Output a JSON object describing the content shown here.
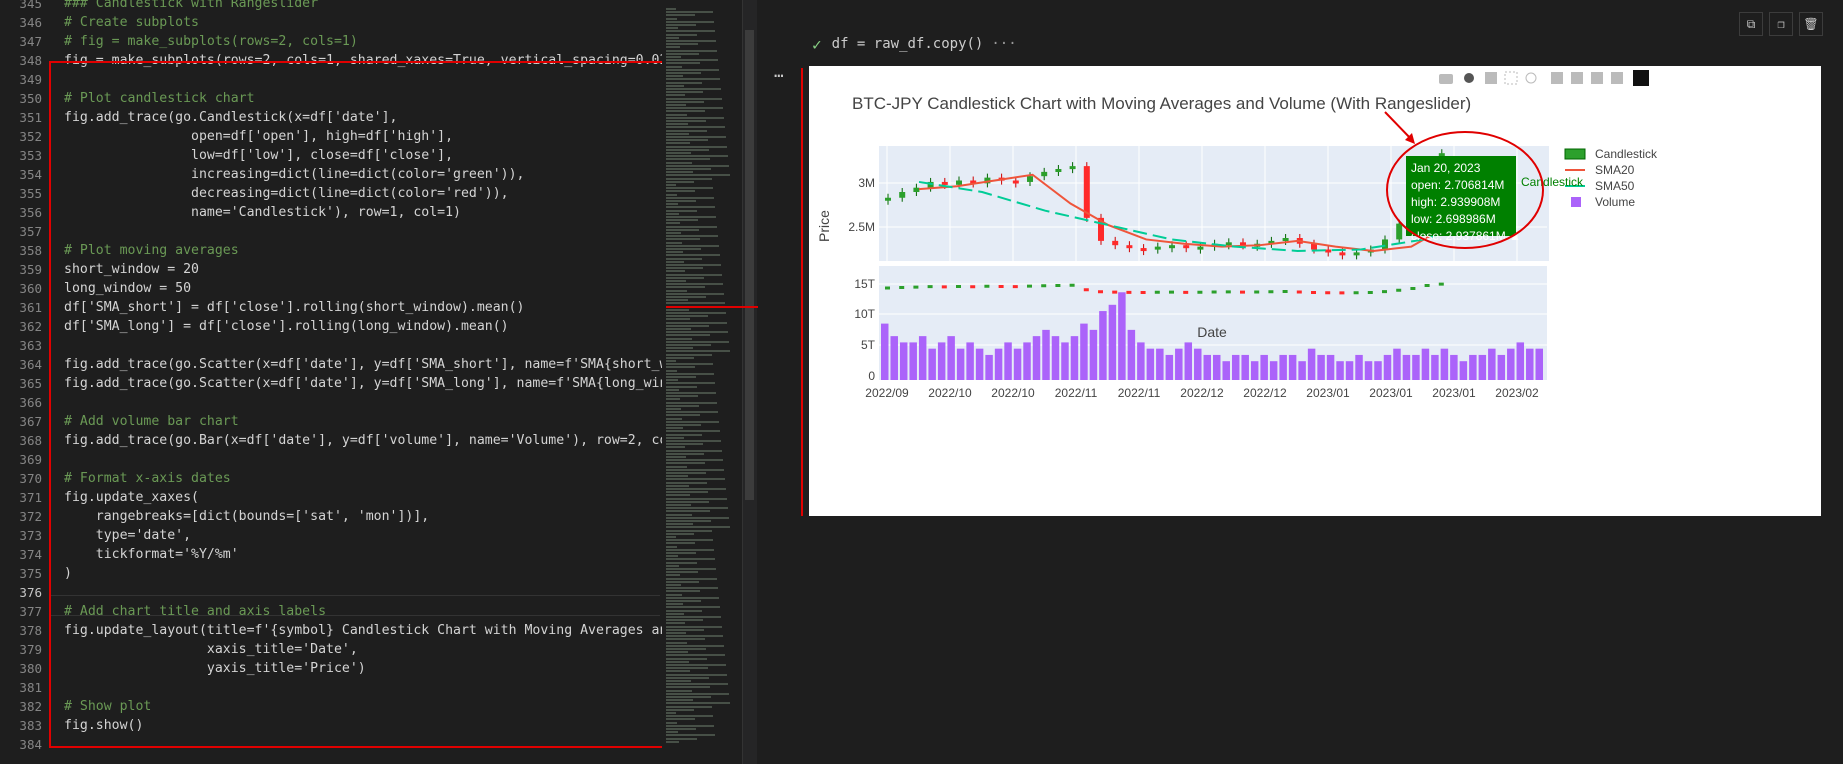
{
  "editor": {
    "line_numbers": [
      "345",
      "346",
      "347",
      "348",
      "349",
      "350",
      "351",
      "352",
      "353",
      "354",
      "355",
      "356",
      "357",
      "358",
      "359",
      "360",
      "361",
      "362",
      "363",
      "364",
      "365",
      "366",
      "367",
      "368",
      "369",
      "370",
      "371",
      "372",
      "373",
      "374",
      "375",
      "376",
      "377",
      "378",
      "379",
      "380",
      "381",
      "382",
      "383",
      "384"
    ],
    "lines": [
      "### Candlestick with Rangeslider",
      "# Create subplots",
      "# fig = make_subplots(rows=2, cols=1)",
      "fig = make_subplots(rows=2, cols=1, shared_xaxes=True, vertical_spacing=0.02)",
      "",
      "# Plot candlestick chart",
      "fig.add_trace(go.Candlestick(x=df['date'],",
      "                open=df['open'], high=df['high'],",
      "                low=df['low'], close=df['close'],",
      "                increasing=dict(line=dict(color='green')),",
      "                decreasing=dict(line=dict(color='red')),",
      "                name='Candlestick'), row=1, col=1)",
      "",
      "# Plot moving averages",
      "short_window = 20",
      "long_window = 50",
      "df['SMA_short'] = df['close'].rolling(short_window).mean()",
      "df['SMA_long'] = df['close'].rolling(long_window).mean()",
      "",
      "fig.add_trace(go.Scatter(x=df['date'], y=df['SMA_short'], name=f'SMA{short_wi",
      "fig.add_trace(go.Scatter(x=df['date'], y=df['SMA_long'], name=f'SMA{long_wind",
      "",
      "# Add volume bar chart",
      "fig.add_trace(go.Bar(x=df['date'], y=df['volume'], name='Volume'), row=2, col",
      "",
      "# Format x-axis dates",
      "fig.update_xaxes(",
      "    rangebreaks=[dict(bounds=['sat', 'mon'])],",
      "    type='date',",
      "    tickformat='%Y/%m'",
      ")",
      "",
      "# Add chart title and axis labels",
      "fig.update_layout(title=f'{symbol} Candlestick Chart with Moving Averages and",
      "                  xaxis_title='Date',",
      "                  yaxis_title='Price')",
      "",
      "# Show plot",
      "fig.show()",
      ""
    ]
  },
  "notebook": {
    "cell_code": "df = raw_df.copy()",
    "cell_more": "···",
    "more_actions": "…",
    "tools": [
      "copy-icon",
      "paste-icon",
      "delete-icon"
    ]
  },
  "plot": {
    "title": "BTC-JPY Candlestick Chart with Moving Averages and Volume (With Rangeslider)",
    "ylabel": "Price",
    "xlabel": "Date",
    "price_ticks": [
      "3M",
      "2.5M"
    ],
    "volume_ticks": [
      "15T",
      "10T",
      "5T",
      "0"
    ],
    "x_ticks": [
      "2022/09",
      "2022/10",
      "2022/10",
      "2022/11",
      "2022/11",
      "2022/12",
      "2022/12",
      "2023/01",
      "2023/01",
      "2023/01",
      "2023/02"
    ],
    "legend": [
      "Candlestick",
      "SMA20",
      "SMA50",
      "Volume"
    ],
    "hover": {
      "date": "Jan 20, 2023",
      "open": "open: 2.706814M",
      "high": "high: 2.939908M",
      "low": "low: 2.698986M",
      "close": "close: 2.937861M ▲",
      "trace": "Candlestick"
    }
  },
  "chart_data": {
    "type": "candlestick",
    "title": "BTC-JPY Candlestick Chart with Moving Averages and Volume (With Rangeslider)",
    "xlabel": "Date",
    "ylabel": "Price",
    "series": [
      {
        "name": "Candlestick",
        "values": [
          2.74,
          2.78,
          2.81,
          2.85,
          2.83,
          2.86,
          2.84,
          2.88,
          2.86,
          2.85,
          2.89,
          2.92,
          2.94,
          2.96,
          2.6,
          2.44,
          2.41,
          2.39,
          2.38,
          2.4,
          2.41,
          2.39,
          2.4,
          2.42,
          2.43,
          2.41,
          2.42,
          2.44,
          2.46,
          2.42,
          2.38,
          2.36,
          2.35,
          2.36,
          2.38,
          2.45,
          2.56,
          2.7,
          2.94,
          3.05
        ]
      },
      {
        "name": "SMA20",
        "values": [
          2.8,
          2.82,
          2.86,
          2.9,
          2.7,
          2.55,
          2.45,
          2.42,
          2.4,
          2.41,
          2.44,
          2.4,
          2.37,
          2.4,
          2.55,
          2.75
        ]
      },
      {
        "name": "SMA50",
        "values": [
          2.85,
          2.78,
          2.65,
          2.55,
          2.45,
          2.4,
          2.37,
          2.38,
          2.45,
          2.6
        ]
      },
      {
        "name": "Volume",
        "values": [
          9,
          7,
          6,
          6,
          7,
          5,
          6,
          7,
          5,
          6,
          5,
          4,
          5,
          6,
          5,
          6,
          7,
          8,
          7,
          6,
          7,
          9,
          8,
          11,
          12,
          14,
          8,
          6,
          5,
          5,
          4,
          5,
          6,
          5,
          4,
          4,
          3,
          4,
          4,
          3,
          4,
          3,
          4,
          4,
          3,
          5,
          4,
          4,
          3,
          3,
          4,
          3,
          3,
          4,
          5,
          4,
          4,
          5,
          4,
          5,
          4,
          3,
          4,
          4,
          5,
          4,
          5,
          6,
          5,
          5
        ]
      }
    ],
    "price_ylim": [
      2.3,
      3.1
    ],
    "volume_ylim": [
      0,
      15
    ]
  }
}
